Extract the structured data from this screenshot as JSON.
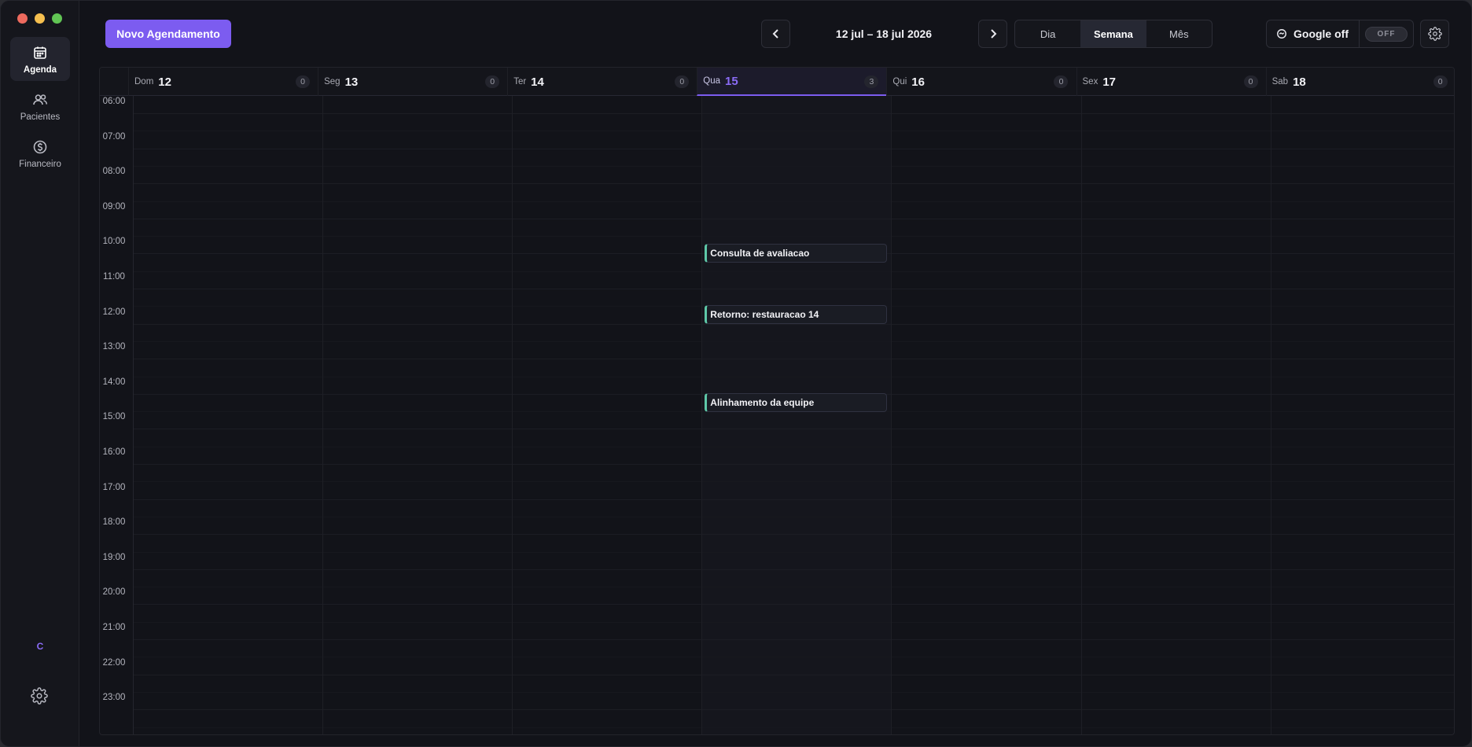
{
  "sidebar": {
    "items": [
      {
        "label": "Agenda",
        "icon": "calendar-icon",
        "active": true
      },
      {
        "label": "Pacientes",
        "icon": "users-icon",
        "active": false
      },
      {
        "label": "Financeiro",
        "icon": "dollar-circle-icon",
        "active": false
      }
    ],
    "user_initial": "C"
  },
  "toolbar": {
    "new_button": "Novo Agendamento",
    "range": "12 jul – 18 jul 2026",
    "views": [
      "Dia",
      "Semana",
      "Mês"
    ],
    "active_view": "Semana",
    "google_label": "Google off",
    "google_toggle": "OFF"
  },
  "calendar": {
    "days": [
      {
        "name": "Dom",
        "num": "12",
        "count": "0"
      },
      {
        "name": "Seg",
        "num": "13",
        "count": "0"
      },
      {
        "name": "Ter",
        "num": "14",
        "count": "0"
      },
      {
        "name": "Qua",
        "num": "15",
        "count": "3",
        "today": true
      },
      {
        "name": "Qui",
        "num": "16",
        "count": "0"
      },
      {
        "name": "Sex",
        "num": "17",
        "count": "0"
      },
      {
        "name": "Sab",
        "num": "18",
        "count": "0"
      }
    ],
    "hours": [
      "06:00",
      "07:00",
      "08:00",
      "09:00",
      "10:00",
      "11:00",
      "12:00",
      "13:00",
      "14:00",
      "15:00",
      "16:00",
      "17:00",
      "18:00",
      "19:00",
      "20:00",
      "21:00",
      "22:00",
      "23:00"
    ],
    "events": [
      {
        "title": "Consulta de avaliacao",
        "day": "Qua 15",
        "start": "09:45"
      },
      {
        "title": "Retorno: restauracao 14",
        "day": "Qua 15",
        "start": "11:30"
      },
      {
        "title": "Alinhamento da equipe",
        "day": "Qua 15",
        "start": "14:00"
      }
    ]
  },
  "colors": {
    "accent": "#7c5cf0",
    "event_bar": "#5ec8a8",
    "background": "#121319"
  }
}
